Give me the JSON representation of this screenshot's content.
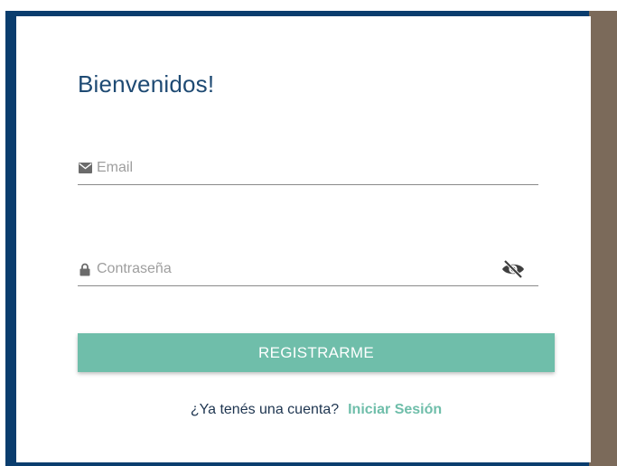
{
  "colors": {
    "accent": "#6fbeaa",
    "title": "#1e4a73",
    "frame_blue": "#0a3d6e",
    "frame_brown": "#7b6a5a"
  },
  "form": {
    "title": "Bienvenidos!",
    "email": {
      "icon": "envelope-icon",
      "placeholder": "Email",
      "value": ""
    },
    "password": {
      "icon": "lock-icon",
      "placeholder": "Contraseña",
      "value": "",
      "toggle_icon": "eye-slash-icon"
    },
    "submit_label": "REGISTRARME",
    "login_prompt": "¿Ya tenés una cuenta?",
    "login_link": "Iniciar Sesión"
  }
}
